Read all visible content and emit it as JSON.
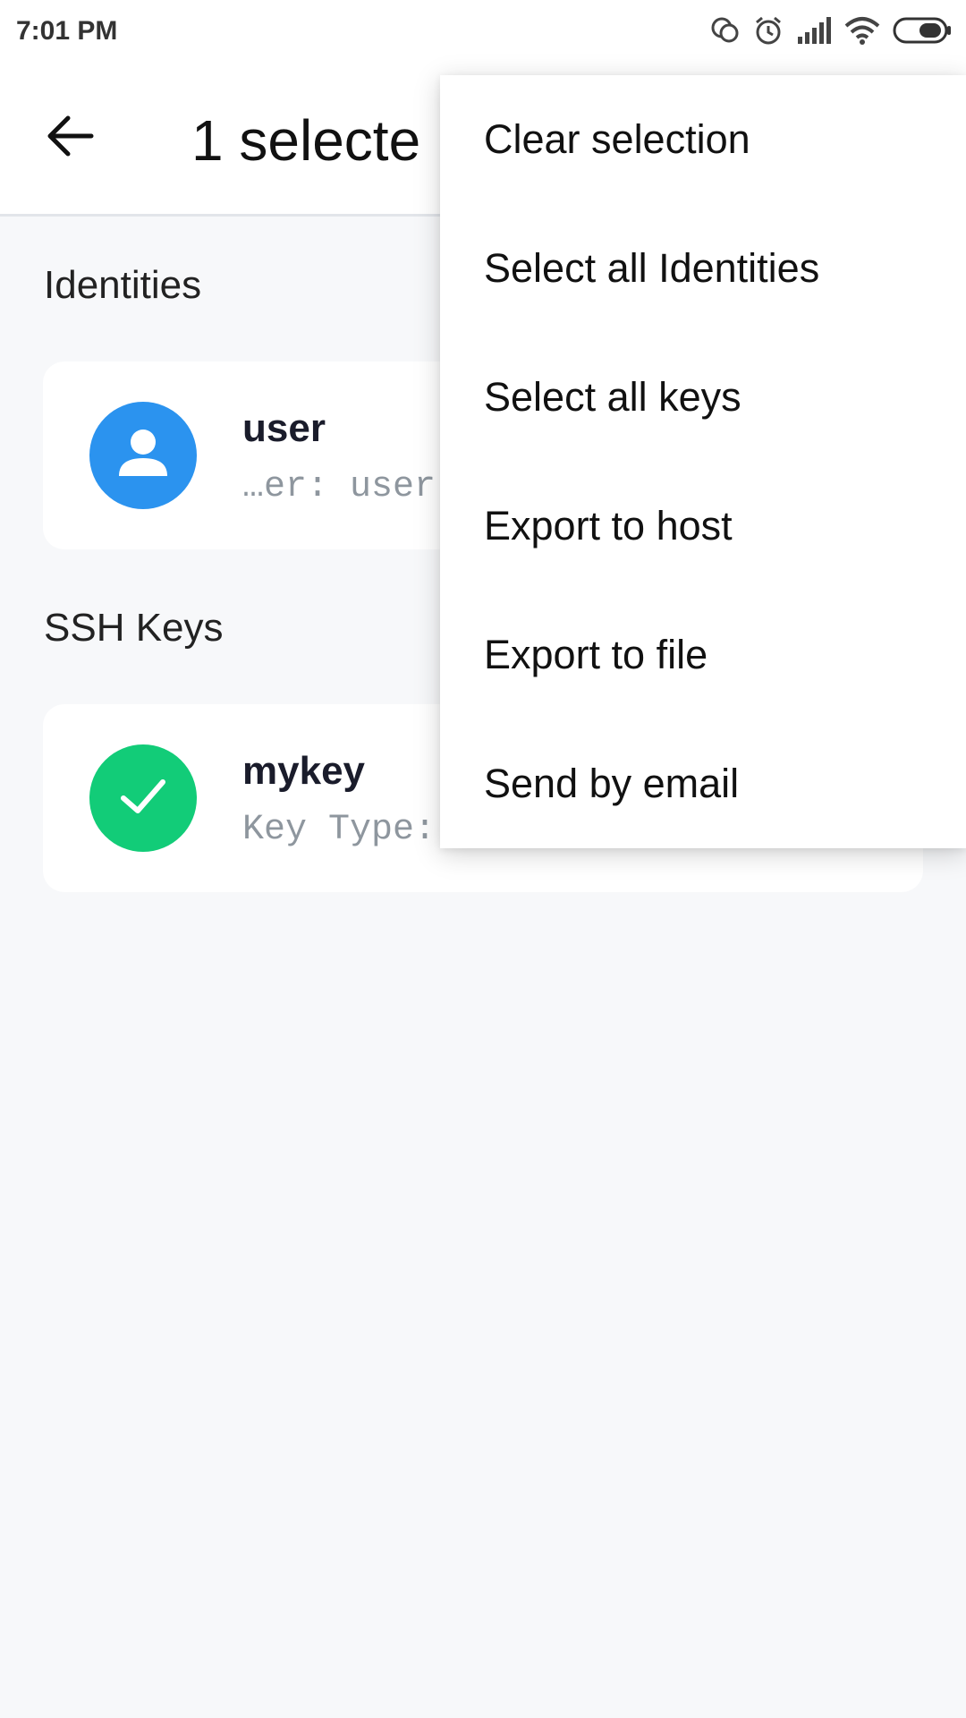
{
  "status_bar": {
    "time": "7:01 PM",
    "icons": [
      "sync-icon",
      "alarm-icon",
      "signal-icon",
      "wifi-icon",
      "battery-icon"
    ]
  },
  "app_bar": {
    "title": "1 selecte"
  },
  "sections": {
    "identities": {
      "header": "Identities",
      "items": [
        {
          "title": "user",
          "subtitle": "…er: user",
          "avatar": "person-icon",
          "color": "#2b93ef"
        }
      ]
    },
    "ssh_keys": {
      "header": "SSH Keys",
      "items": [
        {
          "title": "mykey",
          "subtitle": "Key Type:",
          "avatar": "check-icon",
          "color": "#12cc78"
        }
      ]
    }
  },
  "menu": {
    "items": [
      "Clear selection",
      "Select all Identities",
      "Select all keys",
      "Export to host",
      "Export to file",
      "Send by email"
    ]
  }
}
